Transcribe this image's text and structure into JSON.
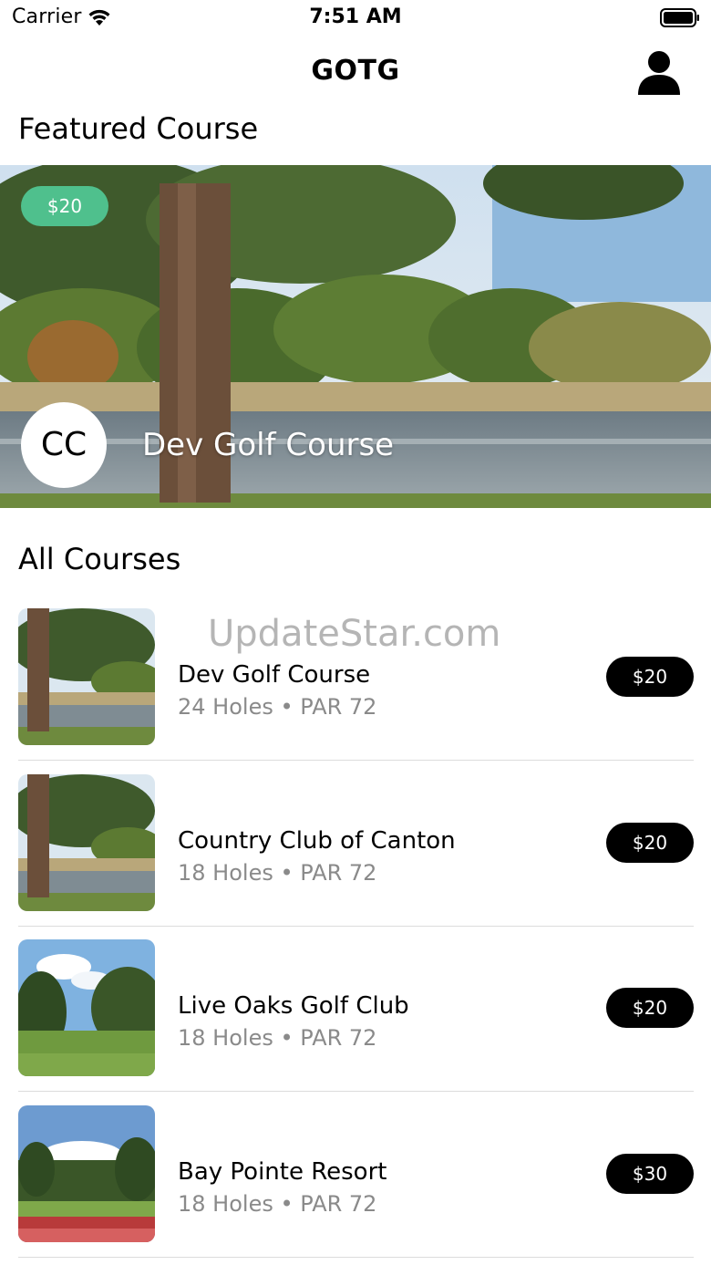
{
  "status_bar": {
    "carrier": "Carrier",
    "time": "7:51 AM"
  },
  "nav": {
    "title": "GOTG",
    "profile_icon": "person-icon"
  },
  "featured": {
    "section_title": "Featured Course",
    "price": "$20",
    "avatar_initials": "CC",
    "name": "Dev Golf Course"
  },
  "all_courses": {
    "section_title": "All Courses",
    "items": [
      {
        "name": "Dev Golf Course",
        "meta": "24 Holes • PAR 72",
        "price": "$20"
      },
      {
        "name": "Country Club of Canton",
        "meta": "18 Holes • PAR 72",
        "price": "$20"
      },
      {
        "name": "Live Oaks Golf Club",
        "meta": "18 Holes • PAR 72",
        "price": "$20"
      },
      {
        "name": "Bay Pointe Resort",
        "meta": "18 Holes • PAR 72",
        "price": "$30"
      }
    ]
  },
  "watermark": "UpdateStar.com",
  "colors": {
    "featured_price_bg": "#4fc08d",
    "price_pill_bg": "#000000",
    "meta_text": "#8a8a8a"
  }
}
